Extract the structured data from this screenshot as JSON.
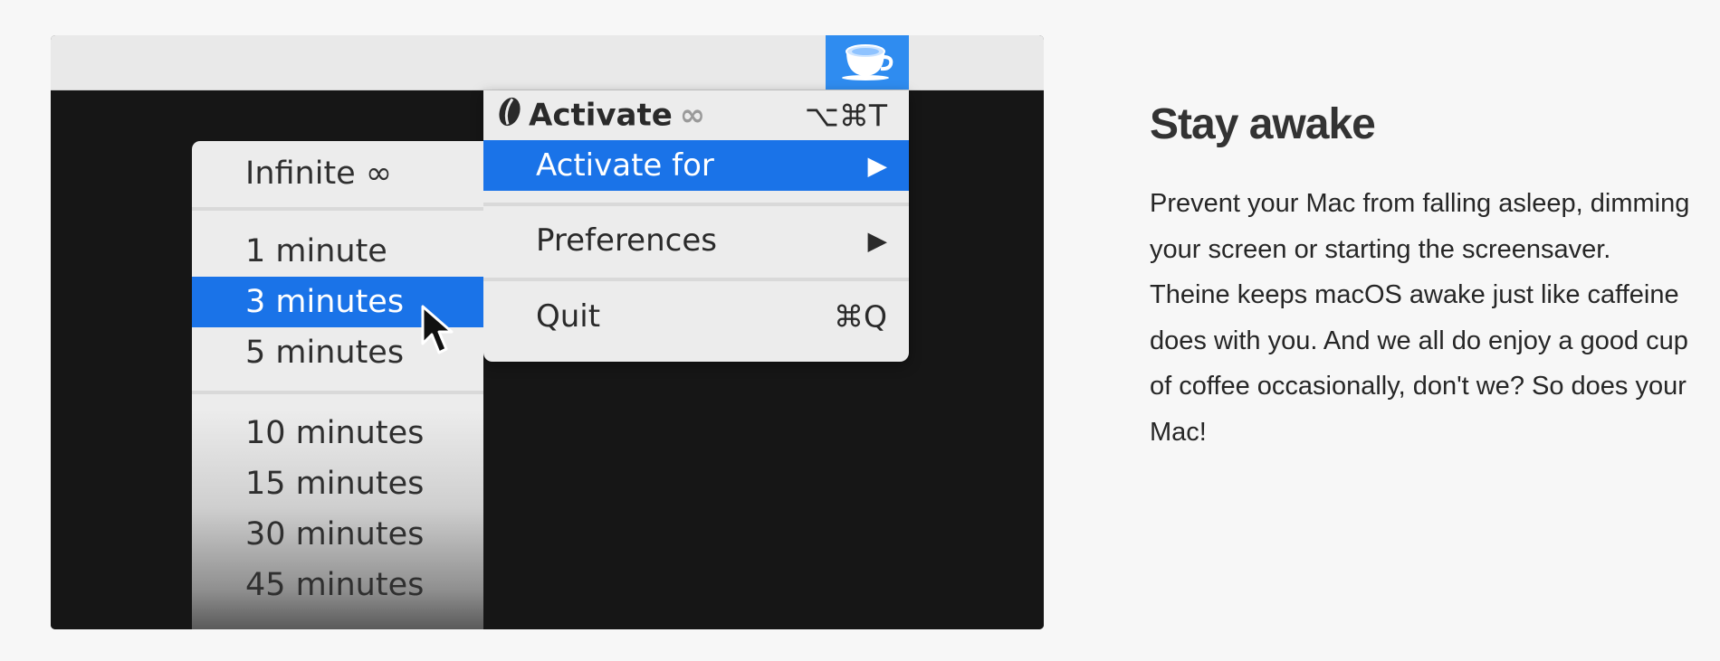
{
  "menubar": {
    "tray_icon": "coffee-cup-icon"
  },
  "main_menu": {
    "activate": {
      "label": "Activate",
      "infinity": "∞",
      "shortcut": "⌥⌘T",
      "icon": "coffee-bean-icon"
    },
    "activate_for": {
      "label": "Activate for",
      "arrow": "▶"
    },
    "preferences": {
      "label": "Preferences",
      "arrow": "▶"
    },
    "quit": {
      "label": "Quit",
      "shortcut": "⌘Q"
    }
  },
  "submenu": {
    "items": [
      {
        "label": "Infinite ∞"
      },
      {
        "label": "1 minute"
      },
      {
        "label": "3 minutes"
      },
      {
        "label": "5 minutes"
      },
      {
        "label": "10 minutes"
      },
      {
        "label": "15 minutes"
      },
      {
        "label": "30 minutes"
      },
      {
        "label": "45 minutes"
      }
    ]
  },
  "colors": {
    "highlight": "#1a73e8",
    "tray": "#2f8cf0",
    "menu_bg": "#ececec"
  },
  "feature": {
    "title": "Stay awake",
    "description": "Prevent your Mac from falling asleep, dimming your screen or starting the screensaver. Theine keeps macOS awake just like caffeine does with you. And we all do enjoy a good cup of coffee occasionally, don't we? So does your Mac!"
  }
}
